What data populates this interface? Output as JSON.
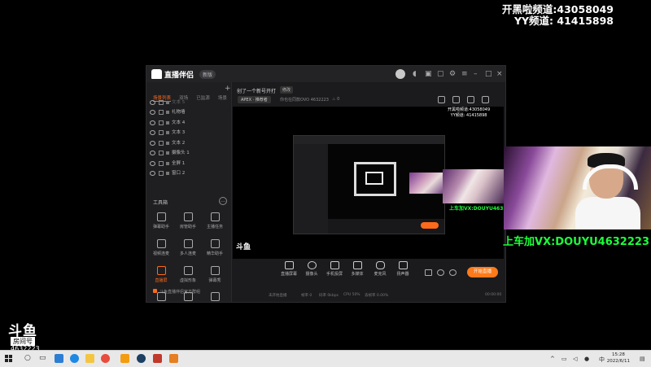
{
  "overlay": {
    "channel_kaiheila": "开黑啦频道:43058049",
    "channel_yy": "YY频道: 41415898",
    "wechat": "上车加VX:DOUYU4632223"
  },
  "douyu_badge": {
    "logo": "斗鱼",
    "room_label": "房间号",
    "room_id": "4632223"
  },
  "app": {
    "name": "直播伴侣",
    "version_badge": "新版",
    "tabs": [
      "场景列表",
      "双场",
      "已监源",
      "场景"
    ],
    "sources": [
      {
        "label": "文本 5",
        "dim": true
      },
      {
        "label": "礼物墙",
        "dim": false
      },
      {
        "label": "文本 4",
        "dim": false
      },
      {
        "label": "文本 3",
        "dim": false
      },
      {
        "label": "文本 2",
        "dim": false
      },
      {
        "label": "摄像头 1",
        "dim": false
      },
      {
        "label": "全屏 1",
        "dim": false
      },
      {
        "label": "窗口 2",
        "dim": false
      }
    ],
    "toolbox_title": "工具箱",
    "tools": [
      {
        "label": "弹幕助手",
        "on": false
      },
      {
        "label": "房管助手",
        "on": false
      },
      {
        "label": "主播任务",
        "on": false
      },
      {
        "label": "视频连麦",
        "on": false
      },
      {
        "label": "多人连麦",
        "on": false
      },
      {
        "label": "精华助手",
        "on": false
      },
      {
        "label": "直播屏",
        "on": true
      },
      {
        "label": "虚拟形象",
        "on": false
      },
      {
        "label": "弹幕秀",
        "on": false
      }
    ],
    "notice": "斗鱼直播伴侣官方群组",
    "stream_title": "创了一个新号开打",
    "edit_label": "修改",
    "category": "APEX · 推荐者",
    "room_info": "你也在同款OVO",
    "room_id": "4632223",
    "likes": "0",
    "preview_overlay_1": "开黑啦频道:43058049",
    "preview_overlay_2": "YY频道: 41415898",
    "inner_wechat": "上车加VX:DOUYU4632223",
    "controls": [
      "直播屏幕",
      "摄像头",
      "手机投屏",
      "多媒体",
      "麦克风",
      "扬声器"
    ],
    "start_button": "开始直播",
    "status": [
      "未开始直播",
      "帧率 0",
      "码率 0kbps",
      "CPU 50%",
      "丢帧率 0.00%",
      "00:00:00"
    ]
  },
  "taskbar": {
    "ime": "中",
    "time": "15:28",
    "date": "2022/6/11"
  },
  "colors": {
    "accent": "#ff6a1a",
    "overlay_green": "#1cff3a"
  }
}
